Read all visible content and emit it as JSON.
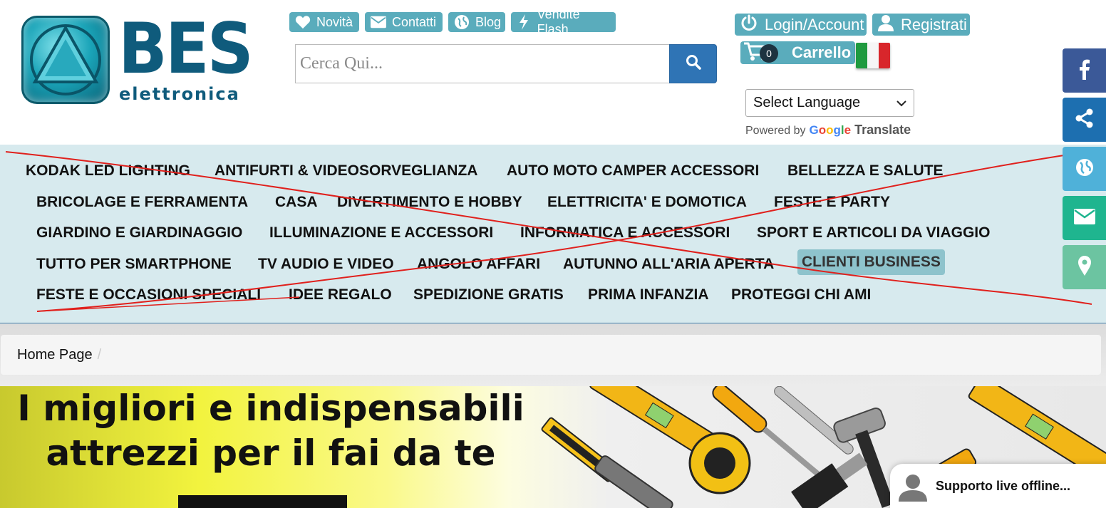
{
  "brand": {
    "name": "BES",
    "subname": "elettronica"
  },
  "top_links": [
    {
      "label": "Novità",
      "icon": "heart-icon"
    },
    {
      "label": "Contatti",
      "icon": "envelope-icon"
    },
    {
      "label": "Blog",
      "icon": "globe-icon"
    },
    {
      "label": "Vendite Flash",
      "icon": "bolt-icon"
    }
  ],
  "search": {
    "placeholder": "Cerca Qui..."
  },
  "account": {
    "login_label": "Login/Account",
    "register_label": "Registrati"
  },
  "cart": {
    "count": "0",
    "label": "Carrello"
  },
  "language": {
    "selected": "Select Language",
    "powered_by": "Powered by",
    "google": "Google",
    "translate": "Translate"
  },
  "categories": [
    "KODAK LED LIGHTING",
    "ANTIFURTI & VIDEOSORVEGLIANZA",
    "AUTO MOTO CAMPER ACCESSORI",
    "BELLEZZA E SALUTE",
    "BRICOLAGE E FERRAMENTA",
    "CASA",
    "DIVERTIMENTO E HOBBY",
    "ELETTRICITA' E DOMOTICA",
    "FESTE E PARTY",
    "GIARDINO E GIARDINAGGIO",
    "ILLUMINAZIONE E ACCESSORI",
    "INFORMATICA E ACCESSORI",
    "SPORT E ARTICOLI DA VIAGGIO",
    "TUTTO PER SMARTPHONE",
    "TV AUDIO E VIDEO",
    "ANGOLO AFFARI",
    "AUTUNNO ALL'ARIA APERTA",
    "CLIENTI BUSINESS",
    "FESTE E OCCASIONI SPECIALI",
    "IDEE REGALO",
    "SPEDIZIONE GRATIS",
    "PRIMA INFANZIA",
    "PROTEGGI CHI AMI"
  ],
  "breadcrumb": {
    "home": "Home Page",
    "separator": "/"
  },
  "banner": {
    "line1": "I migliori e indispensabili",
    "line2": "attrezzi per il fai da te"
  },
  "social": [
    {
      "icon": "facebook-icon",
      "color": "#3b5998"
    },
    {
      "icon": "share-icon",
      "color": "#1d6fb0"
    },
    {
      "icon": "globe-icon",
      "color": "#4fb1d9"
    },
    {
      "icon": "envelope-icon",
      "color": "#1fb58f"
    },
    {
      "icon": "map-pin-icon",
      "color": "#6cc4a1"
    }
  ],
  "chat": {
    "label": "Supporto live offline..."
  },
  "colors": {
    "accent": "#5aacbc",
    "menu_bg": "#d7eaee",
    "search_button": "#2f74b5"
  }
}
